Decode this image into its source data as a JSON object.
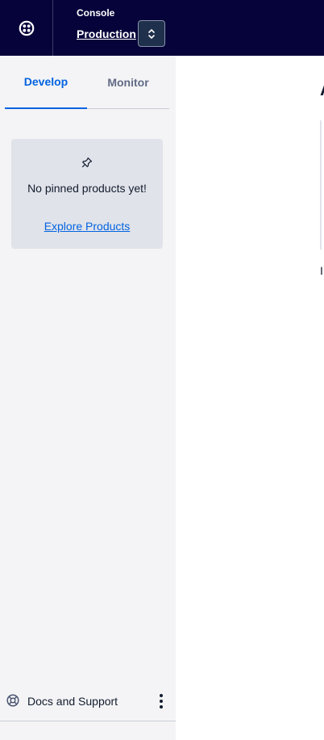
{
  "header": {
    "account_label": "Console",
    "account_name": "Production",
    "logo_icon": "twilio-logo-icon",
    "switch_icon": "chevron-up-down-icon"
  },
  "sidebar": {
    "tabs": [
      {
        "label": "Develop",
        "active": true
      },
      {
        "label": "Monitor",
        "active": false
      }
    ],
    "pinned": {
      "icon": "pin-icon",
      "empty_text": "No pinned products yet!",
      "explore_link": "Explore Products"
    },
    "footer": {
      "icon": "lifebuoy-icon",
      "label": "Docs and Support",
      "menu_icon": "kebab-menu-icon"
    }
  },
  "colors": {
    "topbar_bg": "#06033a",
    "sidebar_bg": "#f4f4f6",
    "accent": "#0263e0",
    "muted_tab": "#606b85"
  }
}
